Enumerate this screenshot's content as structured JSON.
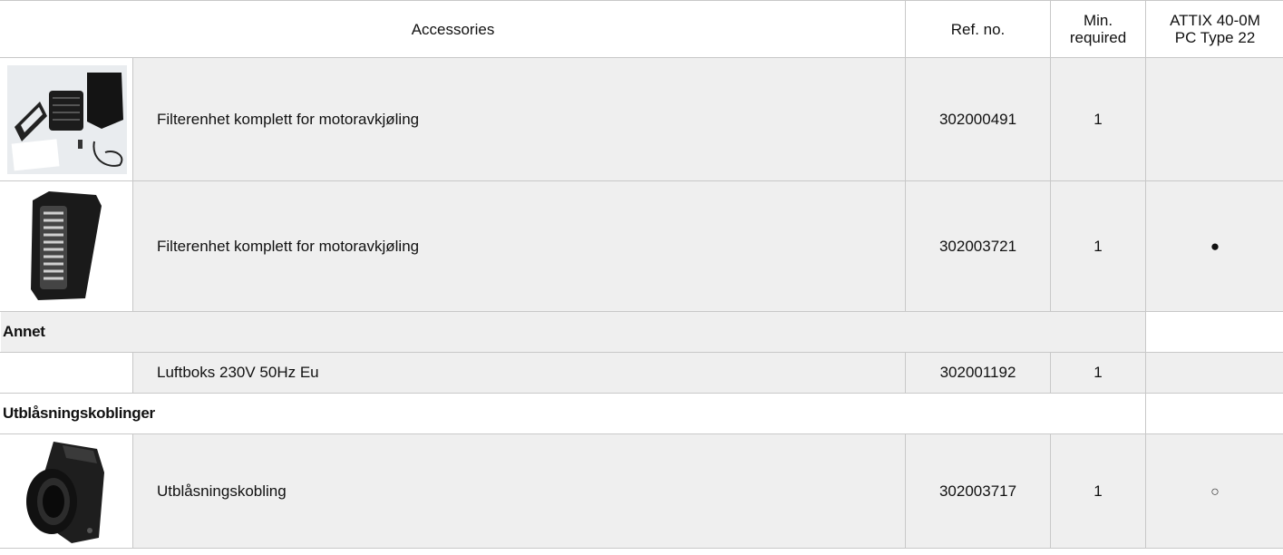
{
  "header": {
    "accessories": "Accessories",
    "ref_no": "Ref. no.",
    "min_required_line1": "Min.",
    "min_required_line2": "required",
    "model_line1": "ATTIX 40-0M",
    "model_line2": "PC Type 22"
  },
  "rows": [
    {
      "image_icon": "filter-kit-parts-icon",
      "description": "Filterenhet komplett for motoravkjøling",
      "ref_no": "302000491",
      "min_required": "1",
      "availability": ""
    },
    {
      "image_icon": "filter-cover-icon",
      "description": "Filterenhet komplett for motoravkjøling",
      "ref_no": "302003721",
      "min_required": "1",
      "availability": "●"
    }
  ],
  "categories": [
    {
      "label": "Annet"
    },
    {
      "label": "Utblåsningskoblinger"
    }
  ],
  "rows_other": [
    {
      "description": "Luftboks 230V 50Hz Eu",
      "ref_no": "302001192",
      "min_required": "1",
      "availability": ""
    }
  ],
  "rows_exhaust": [
    {
      "image_icon": "exhaust-coupling-icon",
      "description": "Utblåsningskobling",
      "ref_no": "302003717",
      "min_required": "1",
      "availability": "○"
    }
  ]
}
